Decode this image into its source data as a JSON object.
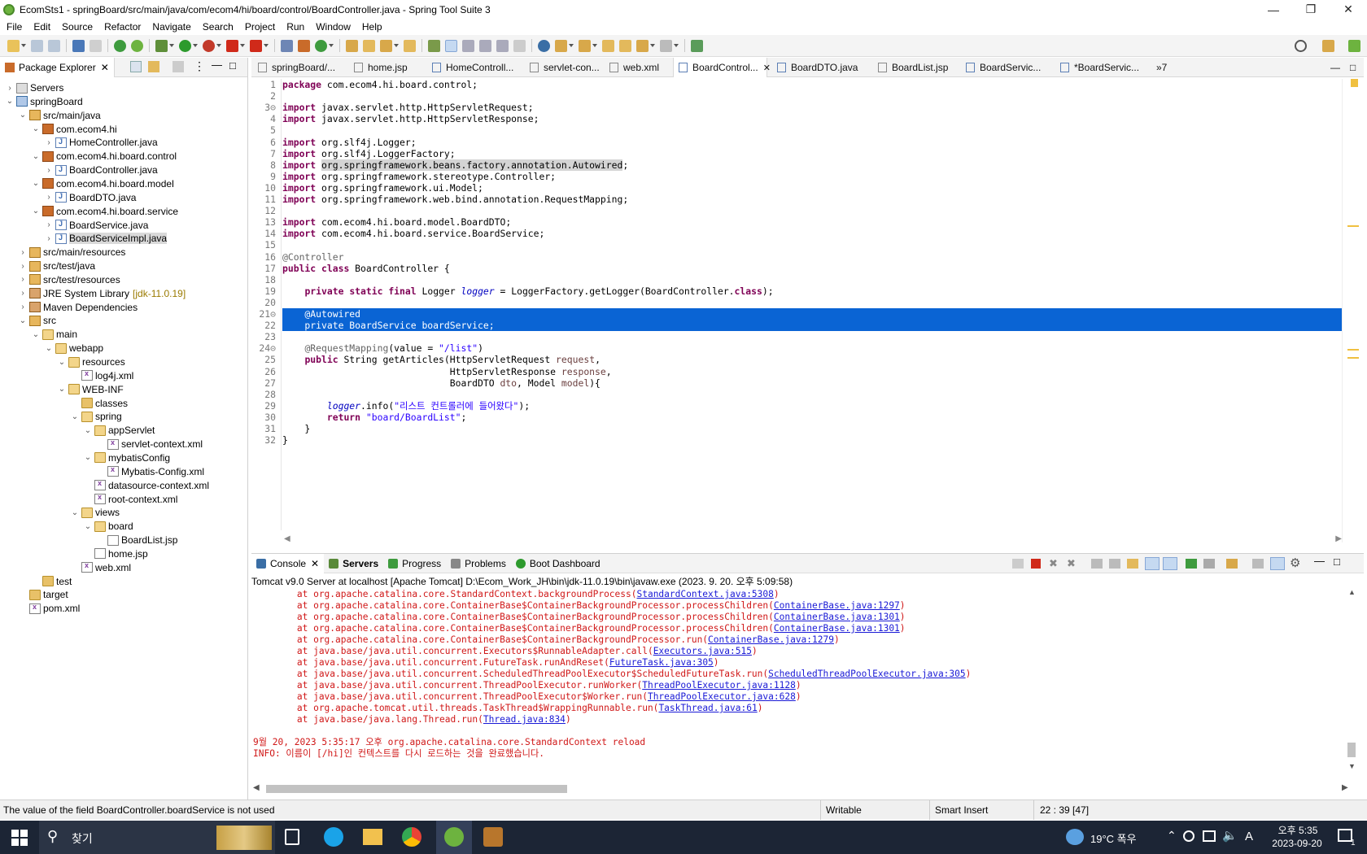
{
  "window": {
    "title": "EcomSts1 - springBoard/src/main/java/com/ecom4/hi/board/control/BoardController.java - Spring Tool Suite 3"
  },
  "menu": [
    "File",
    "Edit",
    "Source",
    "Refactor",
    "Navigate",
    "Search",
    "Project",
    "Run",
    "Window",
    "Help"
  ],
  "explorer": {
    "tab_label": "Package Explorer",
    "items": [
      {
        "label": "Servers",
        "depth": 0,
        "arrow": "›",
        "icon": "servers"
      },
      {
        "label": "springBoard",
        "depth": 0,
        "arrow": "⌄",
        "icon": "proj"
      },
      {
        "label": "src/main/java",
        "depth": 1,
        "arrow": "⌄",
        "icon": "srcf"
      },
      {
        "label": "com.ecom4.hi",
        "depth": 2,
        "arrow": "⌄",
        "icon": "pkg"
      },
      {
        "label": "HomeController.java",
        "depth": 3,
        "arrow": "›",
        "icon": "java"
      },
      {
        "label": "com.ecom4.hi.board.control",
        "depth": 2,
        "arrow": "⌄",
        "icon": "pkg"
      },
      {
        "label": "BoardController.java",
        "depth": 3,
        "arrow": "›",
        "icon": "java"
      },
      {
        "label": "com.ecom4.hi.board.model",
        "depth": 2,
        "arrow": "⌄",
        "icon": "pkg"
      },
      {
        "label": "BoardDTO.java",
        "depth": 3,
        "arrow": "›",
        "icon": "java"
      },
      {
        "label": "com.ecom4.hi.board.service",
        "depth": 2,
        "arrow": "⌄",
        "icon": "pkg"
      },
      {
        "label": "BoardService.java",
        "depth": 3,
        "arrow": "›",
        "icon": "java"
      },
      {
        "label": "BoardServiceImpl.java",
        "depth": 3,
        "arrow": "›",
        "icon": "java",
        "selected": true
      },
      {
        "label": "src/main/resources",
        "depth": 1,
        "arrow": "›",
        "icon": "srcf"
      },
      {
        "label": "src/test/java",
        "depth": 1,
        "arrow": "›",
        "icon": "srcf"
      },
      {
        "label": "src/test/resources",
        "depth": 1,
        "arrow": "›",
        "icon": "srcf"
      },
      {
        "label": "JRE System Library",
        "decoration": "[jdk-11.0.19]",
        "depth": 1,
        "arrow": "›",
        "icon": "lib"
      },
      {
        "label": "Maven Dependencies",
        "depth": 1,
        "arrow": "›",
        "icon": "lib"
      },
      {
        "label": "src",
        "depth": 1,
        "arrow": "⌄",
        "icon": "srcf"
      },
      {
        "label": "main",
        "depth": 2,
        "arrow": "⌄",
        "icon": "openfolder"
      },
      {
        "label": "webapp",
        "depth": 3,
        "arrow": "⌄",
        "icon": "openfolder"
      },
      {
        "label": "resources",
        "depth": 4,
        "arrow": "⌄",
        "icon": "openfolder"
      },
      {
        "label": "log4j.xml",
        "depth": 5,
        "arrow": "",
        "icon": "xml"
      },
      {
        "label": "WEB-INF",
        "depth": 4,
        "arrow": "⌄",
        "icon": "openfolder"
      },
      {
        "label": "classes",
        "depth": 5,
        "arrow": "",
        "icon": "folder"
      },
      {
        "label": "spring",
        "depth": 5,
        "arrow": "⌄",
        "icon": "openfolder"
      },
      {
        "label": "appServlet",
        "depth": 6,
        "arrow": "⌄",
        "icon": "openfolder"
      },
      {
        "label": "servlet-context.xml",
        "depth": 7,
        "arrow": "",
        "icon": "xml"
      },
      {
        "label": "mybatisConfig",
        "depth": 6,
        "arrow": "⌄",
        "icon": "openfolder"
      },
      {
        "label": "Mybatis-Config.xml",
        "depth": 7,
        "arrow": "",
        "icon": "xml"
      },
      {
        "label": "datasource-context.xml",
        "depth": 6,
        "arrow": "",
        "icon": "xml"
      },
      {
        "label": "root-context.xml",
        "depth": 6,
        "arrow": "",
        "icon": "xml"
      },
      {
        "label": "views",
        "depth": 5,
        "arrow": "⌄",
        "icon": "openfolder"
      },
      {
        "label": "board",
        "depth": 6,
        "arrow": "⌄",
        "icon": "openfolder"
      },
      {
        "label": "BoardList.jsp",
        "depth": 7,
        "arrow": "",
        "icon": "jsp"
      },
      {
        "label": "home.jsp",
        "depth": 6,
        "arrow": "",
        "icon": "jsp"
      },
      {
        "label": "web.xml",
        "depth": 5,
        "arrow": "",
        "icon": "xml"
      },
      {
        "label": "test",
        "depth": 2,
        "arrow": "",
        "icon": "folder"
      },
      {
        "label": "target",
        "depth": 1,
        "arrow": "",
        "icon": "folder"
      },
      {
        "label": "pom.xml",
        "depth": 1,
        "arrow": "",
        "icon": "xml"
      }
    ]
  },
  "editor": {
    "tabs": [
      {
        "label": "springBoard/...",
        "icon": "x",
        "active": false
      },
      {
        "label": "home.jsp",
        "icon": "x",
        "active": false
      },
      {
        "label": "HomeControll...",
        "icon": "j",
        "active": false
      },
      {
        "label": "servlet-con...",
        "icon": "x",
        "active": false
      },
      {
        "label": "web.xml",
        "icon": "x",
        "active": false
      },
      {
        "label": "BoardControl...",
        "icon": "j",
        "active": true
      },
      {
        "label": "BoardDTO.java",
        "icon": "j",
        "active": false
      },
      {
        "label": "BoardList.jsp",
        "icon": "x",
        "active": false
      },
      {
        "label": "BoardServic...",
        "icon": "j",
        "active": false
      },
      {
        "label": "*BoardServic...",
        "icon": "j",
        "active": false
      }
    ],
    "tab_overflow": "»7",
    "lines": [
      "package com.ecom4.hi.board.control;",
      "",
      "import javax.servlet.http.HttpServletRequest;",
      "import javax.servlet.http.HttpServletResponse;",
      "",
      "import org.slf4j.Logger;",
      "import org.slf4j.LoggerFactory;",
      "import org.springframework.beans.factory.annotation.Autowired;",
      "import org.springframework.stereotype.Controller;",
      "import org.springframework.ui.Model;",
      "import org.springframework.web.bind.annotation.RequestMapping;",
      "",
      "import com.ecom4.hi.board.model.BoardDTO;",
      "import com.ecom4.hi.board.service.BoardService;",
      "",
      "@Controller",
      "public class BoardController {",
      "",
      "    private static final Logger logger = LoggerFactory.getLogger(BoardController.class);",
      "",
      "    @Autowired",
      "    private BoardService boardService;",
      "",
      "    @RequestMapping(value = \"/list\")",
      "    public String getArticles(HttpServletRequest request,",
      "                              HttpServletResponse response,",
      "                              BoardDTO dto, Model model){",
      "",
      "        logger.info(\"리스트 컨트롤러에 들어왔다\");",
      "        return \"board/BoardList\";",
      "    }",
      "}"
    ]
  },
  "console": {
    "tabs": [
      {
        "label": "Console",
        "active": true
      },
      {
        "label": "Servers",
        "active": false
      },
      {
        "label": "Progress",
        "active": false
      },
      {
        "label": "Problems",
        "active": false
      },
      {
        "label": "Boot Dashboard",
        "active": false
      }
    ],
    "description": "Tomcat v9.0 Server at localhost [Apache Tomcat] D:\\Ecom_Work_JH\\bin\\jdk-11.0.19\\bin\\javaw.exe  (2023. 9. 20. 오후 5:09:58)",
    "trace": [
      {
        "text": "        at org.apache.catalina.core.StandardContext.backgroundProcess(",
        "link": "StandardContext.java:5308",
        "tail": ")"
      },
      {
        "text": "        at org.apache.catalina.core.ContainerBase$ContainerBackgroundProcessor.processChildren(",
        "link": "ContainerBase.java:1297",
        "tail": ")"
      },
      {
        "text": "        at org.apache.catalina.core.ContainerBase$ContainerBackgroundProcessor.processChildren(",
        "link": "ContainerBase.java:1301",
        "tail": ")"
      },
      {
        "text": "        at org.apache.catalina.core.ContainerBase$ContainerBackgroundProcessor.processChildren(",
        "link": "ContainerBase.java:1301",
        "tail": ")"
      },
      {
        "text": "        at org.apache.catalina.core.ContainerBase$ContainerBackgroundProcessor.run(",
        "link": "ContainerBase.java:1279",
        "tail": ")"
      },
      {
        "text": "        at java.base/java.util.concurrent.Executors$RunnableAdapter.call(",
        "link": "Executors.java:515",
        "tail": ")"
      },
      {
        "text": "        at java.base/java.util.concurrent.FutureTask.runAndReset(",
        "link": "FutureTask.java:305",
        "tail": ")"
      },
      {
        "text": "        at java.base/java.util.concurrent.ScheduledThreadPoolExecutor$ScheduledFutureTask.run(",
        "link": "ScheduledThreadPoolExecutor.java:305",
        "tail": ")"
      },
      {
        "text": "        at java.base/java.util.concurrent.ThreadPoolExecutor.runWorker(",
        "link": "ThreadPoolExecutor.java:1128",
        "tail": ")"
      },
      {
        "text": "        at java.base/java.util.concurrent.ThreadPoolExecutor$Worker.run(",
        "link": "ThreadPoolExecutor.java:628",
        "tail": ")"
      },
      {
        "text": "        at org.apache.tomcat.util.threads.TaskThread$WrappingRunnable.run(",
        "link": "TaskThread.java:61",
        "tail": ")"
      },
      {
        "text": "        at java.base/java.lang.Thread.run(",
        "link": "Thread.java:834",
        "tail": ")"
      }
    ],
    "tail_lines": [
      "9월 20, 2023 5:35:17 오후 org.apache.catalina.core.StandardContext reload",
      "INFO: 이름이 [/hi]인 컨텍스트를 다시 로드하는 것을 완료했습니다."
    ]
  },
  "statusbar": {
    "message": "The value of the field BoardController.boardService is not used",
    "writable": "Writable",
    "insert_mode": "Smart Insert",
    "position": "22 : 39 [47]"
  },
  "taskbar": {
    "search_label": "찾기",
    "weather": "19°C  폭우",
    "ime": "A",
    "time": "오후 5:35",
    "date": "2023-09-20",
    "notifications": "1"
  },
  "colors": {
    "selection": "#0a64d4",
    "keyword": "#7f0055",
    "string": "#2a00ff",
    "console_error": "#d01818",
    "taskbar": "#1c2535"
  }
}
